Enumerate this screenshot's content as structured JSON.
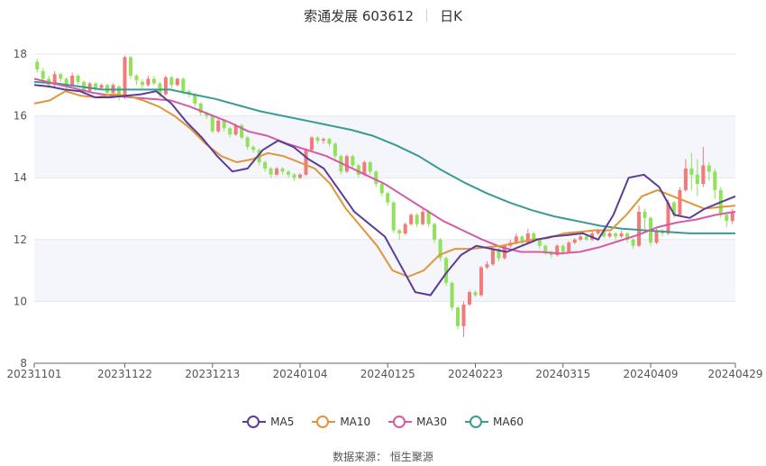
{
  "header": {
    "name": "索通发展 603612",
    "period": "日K"
  },
  "source": {
    "label": "数据来源：",
    "value": "恒生聚源"
  },
  "legend": [
    {
      "label": "MA5",
      "color": "#5b3d96"
    },
    {
      "label": "MA10",
      "color": "#e0953b"
    },
    {
      "label": "MA30",
      "color": "#d65aa6"
    },
    {
      "label": "MA60",
      "color": "#3a9a95"
    }
  ],
  "colors": {
    "up": "#f27a7a",
    "down": "#90e25a"
  },
  "chart_data": {
    "type": "candlestick",
    "ylim": [
      8,
      18
    ],
    "yticks": [
      8,
      10,
      12,
      14,
      16,
      18
    ],
    "grid": "horizontal",
    "legend_position": "bottom",
    "x_tick_labels": [
      "20231101",
      "20231122",
      "20231213",
      "20240104",
      "20240125",
      "20240223",
      "20240315",
      "20240409",
      "20240429"
    ],
    "x_tick_index": [
      0,
      15,
      30,
      45,
      60,
      75,
      90,
      105,
      120
    ],
    "candles": [
      [
        17.75,
        17.5,
        17.85,
        17.4
      ],
      [
        17.45,
        17.2,
        17.55,
        17.1
      ],
      [
        17.2,
        17.0,
        17.3,
        16.9
      ],
      [
        17.0,
        17.35,
        17.45,
        16.95
      ],
      [
        17.35,
        17.2,
        17.4,
        17.1
      ],
      [
        17.2,
        17.0,
        17.25,
        16.8
      ],
      [
        17.0,
        17.3,
        17.4,
        16.95
      ],
      [
        17.3,
        17.1,
        17.35,
        17.0
      ],
      [
        17.1,
        16.8,
        17.15,
        16.7
      ],
      [
        16.8,
        17.05,
        17.1,
        16.75
      ],
      [
        17.05,
        16.9,
        17.1,
        16.8
      ],
      [
        16.9,
        17.0,
        17.05,
        16.85
      ],
      [
        17.0,
        16.75,
        17.05,
        16.65
      ],
      [
        16.75,
        17.0,
        17.05,
        16.7
      ],
      [
        16.95,
        16.6,
        17.0,
        16.5
      ],
      [
        16.6,
        17.9,
        17.95,
        16.55
      ],
      [
        17.9,
        17.3,
        17.95,
        17.2
      ],
      [
        17.3,
        17.15,
        17.35,
        17.0
      ],
      [
        17.1,
        17.0,
        17.2,
        16.9
      ],
      [
        17.0,
        17.2,
        17.3,
        16.95
      ],
      [
        17.2,
        17.05,
        17.3,
        17.0
      ],
      [
        17.05,
        16.7,
        17.1,
        16.6
      ],
      [
        16.7,
        17.25,
        17.3,
        16.65
      ],
      [
        17.25,
        17.0,
        17.3,
        16.9
      ],
      [
        17.0,
        17.2,
        17.25,
        16.95
      ],
      [
        17.2,
        16.8,
        17.25,
        16.7
      ],
      [
        16.8,
        16.7,
        16.85,
        16.6
      ],
      [
        16.7,
        16.4,
        16.75,
        16.3
      ],
      [
        16.4,
        16.1,
        16.45,
        16.0
      ],
      [
        16.1,
        16.0,
        16.15,
        15.9
      ],
      [
        16.0,
        15.5,
        16.05,
        15.45
      ],
      [
        15.5,
        15.85,
        15.9,
        15.45
      ],
      [
        15.85,
        15.6,
        15.9,
        15.5
      ],
      [
        15.6,
        15.4,
        15.65,
        15.3
      ],
      [
        15.4,
        15.7,
        15.75,
        15.35
      ],
      [
        15.7,
        15.3,
        15.75,
        15.25
      ],
      [
        15.3,
        15.0,
        15.35,
        14.9
      ],
      [
        15.0,
        14.9,
        15.05,
        14.8
      ],
      [
        14.9,
        14.5,
        14.95,
        14.4
      ],
      [
        14.5,
        14.3,
        14.55,
        14.2
      ],
      [
        14.3,
        14.1,
        14.35,
        14.0
      ],
      [
        14.1,
        14.3,
        14.35,
        14.05
      ],
      [
        14.3,
        14.2,
        14.35,
        14.1
      ],
      [
        14.2,
        14.1,
        14.25,
        14.0
      ],
      [
        14.1,
        14.0,
        14.15,
        13.9
      ],
      [
        14.0,
        14.1,
        14.15,
        13.95
      ],
      [
        14.1,
        14.9,
        14.95,
        14.05
      ],
      [
        14.9,
        15.3,
        15.35,
        14.85
      ],
      [
        15.3,
        15.2,
        15.35,
        15.1
      ],
      [
        15.2,
        15.25,
        15.3,
        15.1
      ],
      [
        15.25,
        15.1,
        15.3,
        15.0
      ],
      [
        15.1,
        14.7,
        15.15,
        14.6
      ],
      [
        14.7,
        14.2,
        14.75,
        14.1
      ],
      [
        14.2,
        14.7,
        14.75,
        14.15
      ],
      [
        14.7,
        14.4,
        14.75,
        14.3
      ],
      [
        14.4,
        14.1,
        14.45,
        14.0
      ],
      [
        14.1,
        14.5,
        14.55,
        14.05
      ],
      [
        14.5,
        14.2,
        14.55,
        14.1
      ],
      [
        14.2,
        13.8,
        14.25,
        13.7
      ],
      [
        13.8,
        13.5,
        13.85,
        13.4
      ],
      [
        13.5,
        13.2,
        13.55,
        13.1
      ],
      [
        13.2,
        12.3,
        13.25,
        12.2
      ],
      [
        12.3,
        12.2,
        12.35,
        12.0
      ],
      [
        12.2,
        12.5,
        12.55,
        12.15
      ],
      [
        12.5,
        12.8,
        12.85,
        12.45
      ],
      [
        12.8,
        12.5,
        12.85,
        12.4
      ],
      [
        12.5,
        12.9,
        13.0,
        12.45
      ],
      [
        12.9,
        12.5,
        12.95,
        12.4
      ],
      [
        12.5,
        12.0,
        12.55,
        11.9
      ],
      [
        12.0,
        11.4,
        12.05,
        11.3
      ],
      [
        11.4,
        10.6,
        11.45,
        10.5
      ],
      [
        10.6,
        9.8,
        10.65,
        9.7
      ],
      [
        9.8,
        9.2,
        9.85,
        9.1
      ],
      [
        9.2,
        9.9,
        10.0,
        8.85
      ],
      [
        9.9,
        10.3,
        10.35,
        9.85
      ],
      [
        10.3,
        10.2,
        10.35,
        10.15
      ],
      [
        10.2,
        11.1,
        11.15,
        10.15
      ],
      [
        11.1,
        11.2,
        11.3,
        11.05
      ],
      [
        11.2,
        11.7,
        11.75,
        11.15
      ],
      [
        11.7,
        11.4,
        11.75,
        11.3
      ],
      [
        11.4,
        11.8,
        11.85,
        11.35
      ],
      [
        11.8,
        11.9,
        12.0,
        11.75
      ],
      [
        11.9,
        12.1,
        12.2,
        11.85
      ],
      [
        12.1,
        11.9,
        12.15,
        11.8
      ],
      [
        11.9,
        12.2,
        12.35,
        11.85
      ],
      [
        12.2,
        12.0,
        12.25,
        11.9
      ],
      [
        12.0,
        11.8,
        12.05,
        11.7
      ],
      [
        11.8,
        11.6,
        11.85,
        11.5
      ],
      [
        11.6,
        11.5,
        11.65,
        11.4
      ],
      [
        11.5,
        11.8,
        11.85,
        11.45
      ],
      [
        11.8,
        11.6,
        11.85,
        11.5
      ],
      [
        11.6,
        11.9,
        11.95,
        11.55
      ],
      [
        11.9,
        12.0,
        12.05,
        11.85
      ],
      [
        12.0,
        12.1,
        12.15,
        11.95
      ],
      [
        12.1,
        12.0,
        12.15,
        11.95
      ],
      [
        12.0,
        12.2,
        12.3,
        11.95
      ],
      [
        12.2,
        12.3,
        12.35,
        12.15
      ],
      [
        12.3,
        12.1,
        12.35,
        12.05
      ],
      [
        12.1,
        12.2,
        12.25,
        12.05
      ],
      [
        12.2,
        12.1,
        12.25,
        12.0
      ],
      [
        12.1,
        12.2,
        12.3,
        12.05
      ],
      [
        12.2,
        12.0,
        12.25,
        11.9
      ],
      [
        12.0,
        11.8,
        12.05,
        11.7
      ],
      [
        11.8,
        12.9,
        13.1,
        11.75
      ],
      [
        12.9,
        12.7,
        13.0,
        12.3
      ],
      [
        12.7,
        11.9,
        12.75,
        11.8
      ],
      [
        11.9,
        12.3,
        12.35,
        11.85
      ],
      [
        12.3,
        12.2,
        12.35,
        12.1
      ],
      [
        12.2,
        13.2,
        13.3,
        12.15
      ],
      [
        13.2,
        12.8,
        13.25,
        12.7
      ],
      [
        12.8,
        13.6,
        13.7,
        12.75
      ],
      [
        13.6,
        14.3,
        14.6,
        13.55
      ],
      [
        14.3,
        14.1,
        14.8,
        13.6
      ],
      [
        14.1,
        13.8,
        14.6,
        13.4
      ],
      [
        13.8,
        14.4,
        15.0,
        13.7
      ],
      [
        14.4,
        14.2,
        14.5,
        13.9
      ],
      [
        14.2,
        13.6,
        14.3,
        13.3
      ],
      [
        13.6,
        12.8,
        13.7,
        12.7
      ],
      [
        12.8,
        12.6,
        12.9,
        12.4
      ],
      [
        12.6,
        12.9,
        13.0,
        12.5
      ]
    ],
    "ma": {
      "MA5": [
        17.0,
        16.95,
        16.85,
        16.8,
        16.6,
        16.6,
        16.65,
        16.7,
        16.8,
        16.4,
        15.8,
        15.3,
        14.7,
        14.2,
        14.3,
        14.9,
        15.2,
        15.0,
        14.6,
        14.3,
        13.6,
        12.9,
        12.5,
        12.1,
        11.2,
        10.3,
        10.2,
        10.9,
        11.5,
        11.8,
        11.7,
        11.6,
        11.8,
        12.0,
        12.1,
        12.15,
        12.2,
        12.0,
        12.8,
        14.0,
        14.1,
        13.7,
        12.8,
        12.7,
        13.0,
        13.2,
        13.4
      ],
      "MA10": [
        16.4,
        16.5,
        16.8,
        16.65,
        16.6,
        16.7,
        16.65,
        16.5,
        16.3,
        16.0,
        15.6,
        15.1,
        14.7,
        14.5,
        14.6,
        14.8,
        14.7,
        14.5,
        14.3,
        13.8,
        13.0,
        12.4,
        11.8,
        11.0,
        10.8,
        11.0,
        11.5,
        11.7,
        11.7,
        11.75,
        11.8,
        11.9,
        12.0,
        12.05,
        12.2,
        12.25,
        12.3,
        12.3,
        12.8,
        13.4,
        13.6,
        13.4,
        13.2,
        13.0,
        13.05,
        13.1
      ],
      "MA30": [
        17.2,
        17.05,
        16.9,
        16.75,
        16.65,
        16.6,
        16.55,
        16.5,
        16.3,
        16.05,
        15.8,
        15.5,
        15.35,
        15.1,
        14.9,
        14.7,
        14.4,
        14.1,
        13.8,
        13.4,
        13.0,
        12.6,
        12.3,
        12.0,
        11.75,
        11.6,
        11.6,
        11.55,
        11.6,
        11.75,
        11.95,
        12.15,
        12.4,
        12.55,
        12.65,
        12.8,
        12.9
      ],
      "MA60": [
        17.1,
        17.05,
        16.95,
        16.85,
        16.85,
        16.85,
        16.85,
        16.7,
        16.55,
        16.35,
        16.15,
        16.0,
        15.85,
        15.7,
        15.55,
        15.35,
        15.05,
        14.7,
        14.25,
        13.85,
        13.5,
        13.2,
        12.95,
        12.75,
        12.6,
        12.45,
        12.35,
        12.3,
        12.25,
        12.2,
        12.2,
        12.2
      ]
    }
  }
}
